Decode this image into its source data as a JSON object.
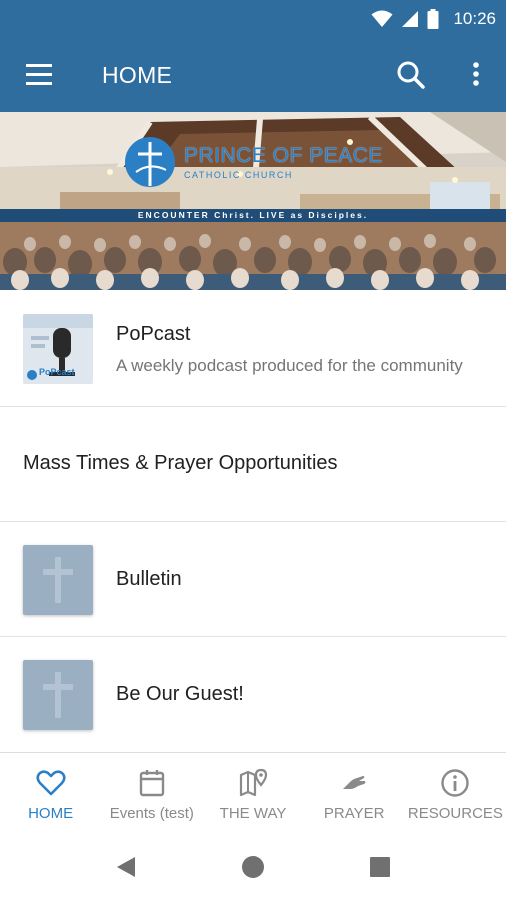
{
  "status_bar": {
    "time": "10:26",
    "icons": [
      "wifi-icon",
      "cell-signal-icon",
      "battery-icon"
    ]
  },
  "app_bar": {
    "title": "HOME",
    "icons": [
      "menu-icon",
      "search-icon",
      "more-vert-icon"
    ]
  },
  "banner": {
    "title": "PRINCE OF PEACE",
    "subtitle": "CATHOLIC CHURCH",
    "tagline": "ENCOUNTER Christ. LIVE as Disciples."
  },
  "list": {
    "items": [
      {
        "title": "PoPcast",
        "subtitle": "A weekly podcast produced for the community",
        "thumb_text": "PoPcast"
      },
      {
        "title": "Mass Times & Prayer Opportunities"
      },
      {
        "title": "Bulletin",
        "icon": "cross-icon"
      },
      {
        "title": "Be Our Guest!",
        "icon": "cross-icon"
      }
    ]
  },
  "bottom_nav": {
    "items": [
      {
        "label": "HOME",
        "icon": "heart-icon",
        "active": true
      },
      {
        "label": "Events (test)",
        "icon": "calendar-icon",
        "active": false
      },
      {
        "label": "THE WAY",
        "icon": "map-pin-icon",
        "active": false
      },
      {
        "label": "PRAYER",
        "icon": "praying-hand-icon",
        "active": false
      },
      {
        "label": "RESOURCES",
        "icon": "info-icon",
        "active": false
      }
    ]
  },
  "system_nav": {
    "icons": [
      "back-icon",
      "home-circle-icon",
      "recents-icon"
    ]
  },
  "colors": {
    "primary": "#2f6d9e",
    "accent": "#2b7fc4",
    "inactive": "#8a8a8a",
    "thumb_placeholder": "#9bafc2"
  }
}
